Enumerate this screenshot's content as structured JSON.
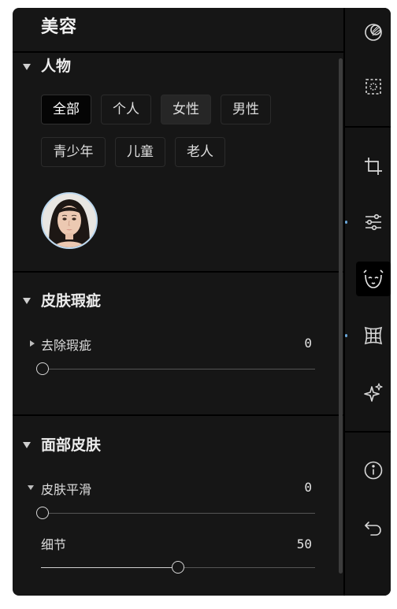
{
  "header": {
    "title": "美容"
  },
  "sections": {
    "people": {
      "title": "人物",
      "chips": [
        "全部",
        "个人",
        "女性",
        "男性",
        "青少年",
        "儿童",
        "老人"
      ],
      "selected_chip": "全部"
    },
    "blemish": {
      "title": "皮肤瑕疵",
      "sliders": [
        {
          "label": "去除瑕疵",
          "value": "0",
          "level_fraction": 0.0
        }
      ]
    },
    "face_skin": {
      "title": "面部皮肤",
      "sliders": [
        {
          "label": "皮肤平滑",
          "value": "0",
          "level_fraction": 0.0
        },
        {
          "label": "细节",
          "value": "50",
          "level_fraction": 0.5
        }
      ]
    }
  },
  "rail": {
    "icons": [
      "color-circles-icon",
      "selection-icon",
      "crop-icon",
      "adjust-sliders-icon",
      "face-beauty-icon",
      "warp-grid-icon",
      "sparkle-icon",
      "info-icon",
      "undo-icon"
    ],
    "active_icon": "face-beauty-icon"
  },
  "colors": {
    "panel_bg": "#161616",
    "rail_bg": "#141414",
    "accent_dot": "#6aa6d8",
    "avatar_ring": "#bcd8ef"
  }
}
